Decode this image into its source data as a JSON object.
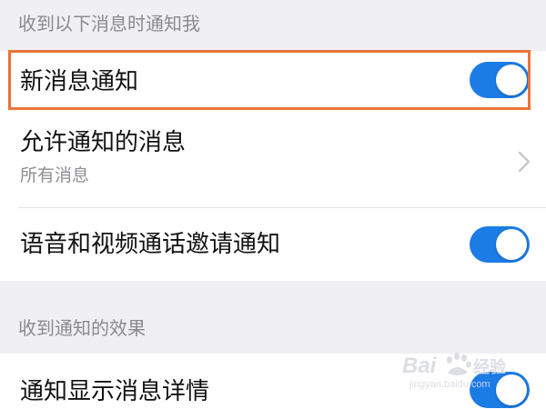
{
  "section1": {
    "header": "收到以下消息时通知我",
    "items": [
      {
        "title": "新消息通知",
        "control": "toggle",
        "on": true
      },
      {
        "title": "允许通知的消息",
        "subtitle": "所有消息",
        "control": "chevron"
      },
      {
        "title": "语音和视频通话邀请通知",
        "control": "toggle",
        "on": true
      }
    ]
  },
  "section2": {
    "header": "收到通知的效果",
    "items": [
      {
        "title": "通知显示消息详情",
        "control": "toggle",
        "on": true
      }
    ]
  },
  "colors": {
    "toggle_on": "#1c7ce6",
    "highlight_border": "#e9743b",
    "background": "#efeff4"
  },
  "icons": {
    "chevron": "chevron-right-icon"
  },
  "watermark": {
    "line1": "Bai",
    "line2": "经验",
    "line3": "jingyan.baidu.com"
  }
}
